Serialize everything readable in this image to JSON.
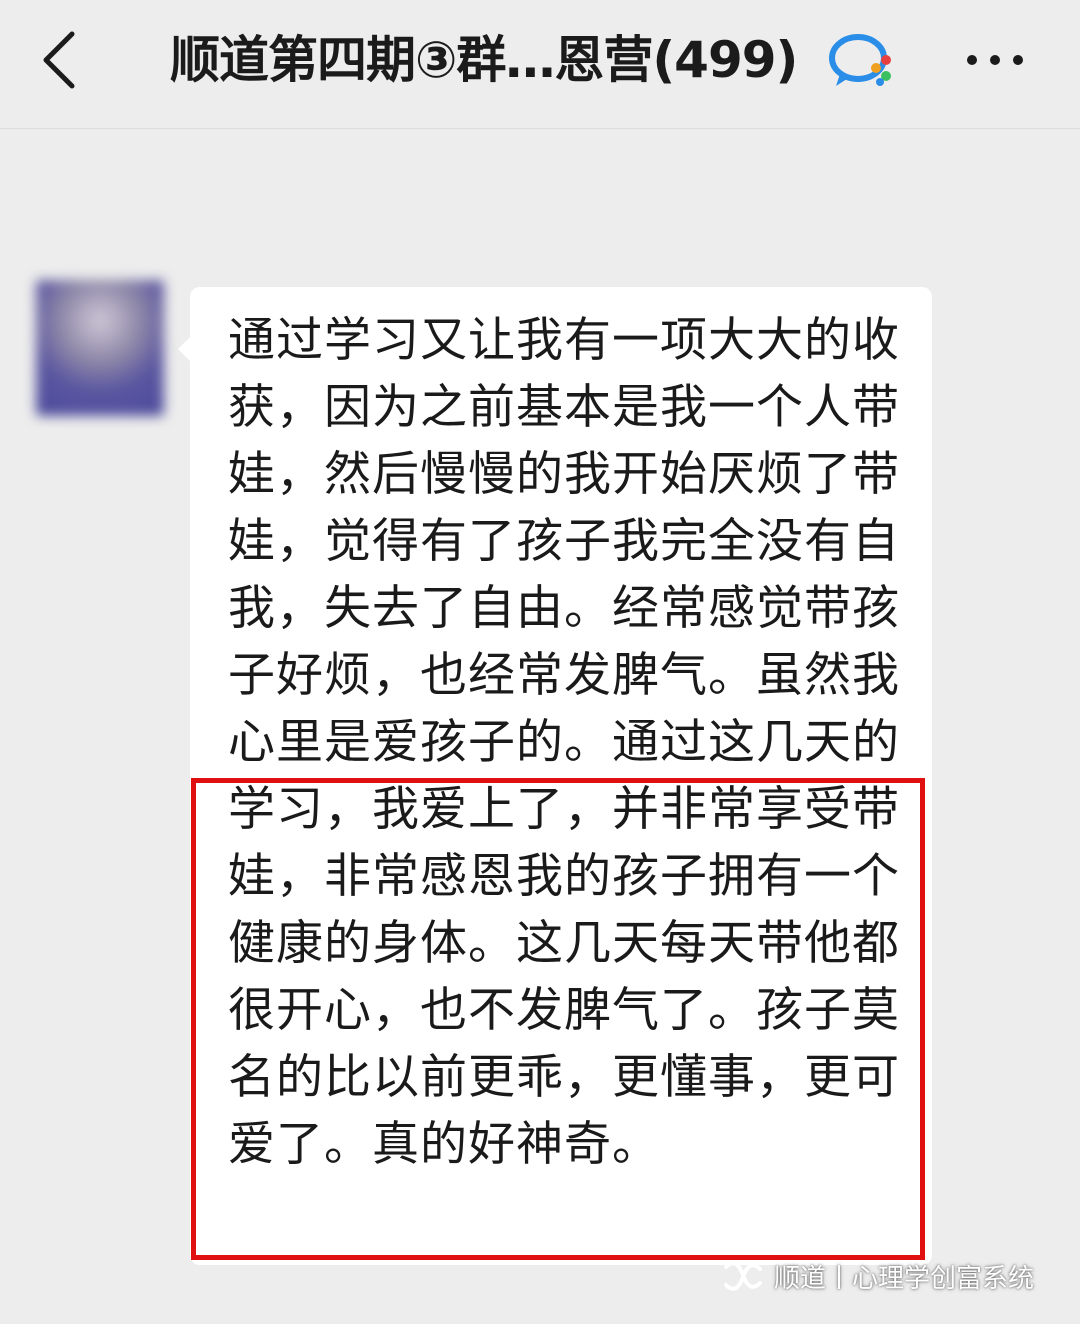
{
  "header": {
    "title": "顺道第四期③群…恩营(499)",
    "back_icon": "chevron-left-icon",
    "group_icon": "group-chat-badge-icon",
    "more_icon": "more-dots-icon"
  },
  "message": {
    "text": "通过学习又让我有一项大大的收获，因为之前基本是我一个人带娃，然后慢慢的我开始厌烦了带娃，觉得有了孩子我完全没有自我，失去了自由。经常感觉带孩子好烦，也经常发脾气。虽然我心里是爱孩子的。通过这几天的学习，我爱上了，并非常享受带娃，非常感恩我的孩子拥有一个健康的身体。这几天每天带他都很开心，也不发脾气了。孩子莫名的比以前更乖，更懂事，更可爱了。真的好神奇。",
    "highlight_color": "#e01010",
    "bubble_color": "#ffffff"
  },
  "watermark": {
    "text": "顺道丨心理学创富系统",
    "logo_icon": "wechat-channel-icon"
  },
  "colors": {
    "background": "#ededed",
    "title": "#1b1b1b"
  }
}
